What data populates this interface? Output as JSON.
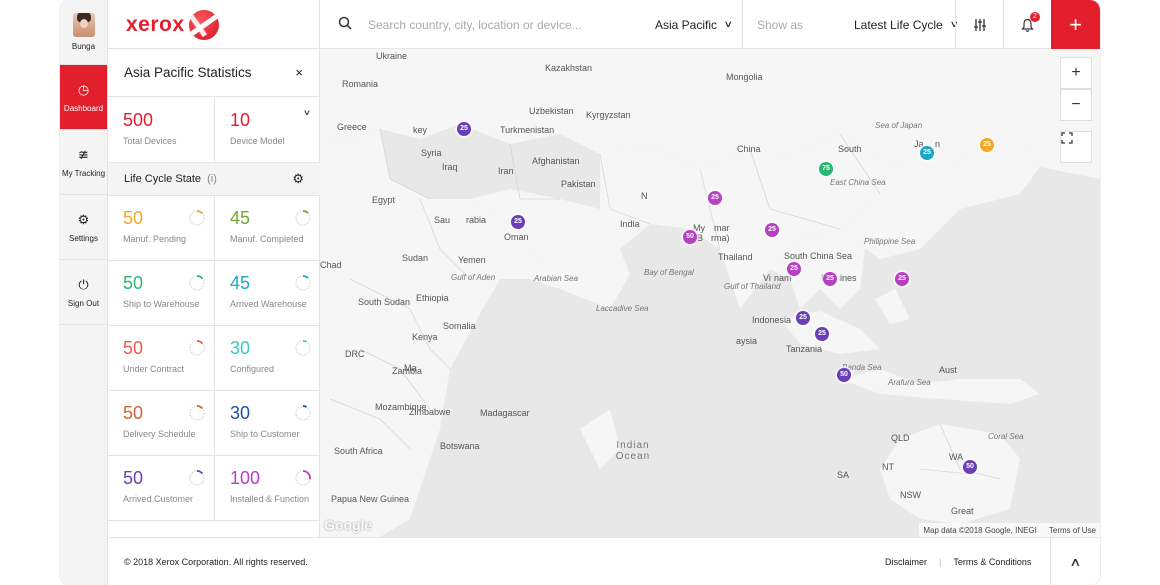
{
  "user": {
    "name": "Bunga"
  },
  "nav": [
    {
      "label": "Dashboard",
      "icon": "gauge-icon",
      "active": true
    },
    {
      "label": "My Tracking",
      "icon": "rss-icon",
      "active": false
    },
    {
      "label": "Settings",
      "icon": "gear-icon",
      "active": false
    },
    {
      "label": "Sign Out",
      "icon": "power-icon",
      "active": false
    }
  ],
  "brand": {
    "name": "xerox",
    "color": "#e41f2d"
  },
  "header": {
    "search_placeholder": "Search country, city, location or device...",
    "region": "Asia Pacific",
    "show_as": "Show as",
    "lifecycle_select": "Latest Life Cycle",
    "notifications_count": "2"
  },
  "panel": {
    "title": "Asia Pacific Statistics",
    "close": "×",
    "total_devices": {
      "value": "500",
      "label": "Total Devices"
    },
    "device_model": {
      "value": "10",
      "label": "Device Model"
    },
    "lifecycle_title": "Life Cycle State",
    "lifecycle_info": "(i)",
    "states": [
      {
        "value": "50",
        "label": "Manuf. Pending",
        "color": "#f5a623",
        "fraction": 0.1
      },
      {
        "value": "45",
        "label": "Manuf. Completed",
        "color": "#6aab2f",
        "fraction": 0.09
      },
      {
        "value": "50",
        "label": "Ship to Warehouse",
        "color": "#2bb673",
        "fraction": 0.1
      },
      {
        "value": "45",
        "label": "Arrived Warehouse",
        "color": "#1aa7c9",
        "fraction": 0.09
      },
      {
        "value": "50",
        "label": "Under Contract",
        "color": "#f0574f",
        "fraction": 0.1
      },
      {
        "value": "30",
        "label": "Configured",
        "color": "#3cc9c0",
        "fraction": 0.06
      },
      {
        "value": "50",
        "label": "Delivery Schedule",
        "color": "#d2642f",
        "fraction": 0.1
      },
      {
        "value": "30",
        "label": "Ship to Customer",
        "color": "#1f4fa3",
        "fraction": 0.06
      },
      {
        "value": "50",
        "label": "Arrived Customer",
        "color": "#6a3fb5",
        "fraction": 0.1
      },
      {
        "value": "100",
        "label": "Installed & Function",
        "color": "#b63fc4",
        "fraction": 0.2
      }
    ]
  },
  "map": {
    "countries": [
      "Ukraine",
      "Kazakhstan",
      "Mongolia",
      "Romania",
      "Uzbekistan",
      "Kyrgyzstan",
      "Greece",
      "key",
      "Turkmenistan",
      "Syria",
      "Iraq",
      "Afghanistan",
      "Iran",
      "China",
      "South",
      "Ja",
      "n",
      "Pakistan",
      "Egypt",
      "Sau",
      "rabia",
      "N",
      "India",
      "Oman",
      "My",
      "mar",
      "(B",
      "rma)",
      "Sudan",
      "Chad",
      "Yemen",
      "Thailand",
      "South China Sea",
      "Phi",
      "ines",
      "Vi",
      "nam",
      "South Sudan",
      "Ethiopia",
      "Somalia",
      "Kenya",
      "DRC",
      "Ma",
      "aysia",
      "Indonesia",
      "Tanzania",
      "Zambia",
      "Mozambique",
      "Zimbabwe",
      "Madagascar",
      "Botswana",
      "South Africa",
      "Papua New Guinea",
      "Aust",
      "NT",
      "QLD",
      "WA",
      "SA",
      "NSW",
      "Great"
    ],
    "seas": [
      "Sea of Japan",
      "East China Sea",
      "Philippine Sea",
      "Gulf of Aden",
      "Arabian Sea",
      "Bay of Bengal",
      "Gulf of Thailand",
      "Laccadive Sea",
      "Banda Sea",
      "Arafura Sea",
      "Coral Sea"
    ],
    "ocean": "Indian Ocean",
    "markers": [
      {
        "value": "25",
        "color": "#6a3fb5"
      },
      {
        "value": "75",
        "color": "#2bb673"
      },
      {
        "value": "25",
        "color": "#1aa7c9"
      },
      {
        "value": "25",
        "color": "#f5a623"
      },
      {
        "value": "25",
        "color": "#b63fc4"
      },
      {
        "value": "25",
        "color": "#6a3fb5"
      },
      {
        "value": "50",
        "color": "#b63fc4"
      },
      {
        "value": "25",
        "color": "#b63fc4"
      },
      {
        "value": "25",
        "color": "#b63fc4"
      },
      {
        "value": "25",
        "color": "#b63fc4"
      },
      {
        "value": "25",
        "color": "#b63fc4"
      },
      {
        "value": "25",
        "color": "#6a3fb5"
      },
      {
        "value": "25",
        "color": "#6a3fb5"
      },
      {
        "value": "50",
        "color": "#6a3fb5"
      },
      {
        "value": "50",
        "color": "#6a3fb5"
      }
    ],
    "zoom_in": "+",
    "zoom_out": "−",
    "google": "Google",
    "attribution": "Map data ©2018 Google, INEGI",
    "terms": "Terms of Use"
  },
  "footer": {
    "copyright": "© 2018 Xerox Corporation. All rights reserved.",
    "disclaimer": "Disclaimer",
    "separator": "|",
    "terms": "Terms & Conditions"
  }
}
